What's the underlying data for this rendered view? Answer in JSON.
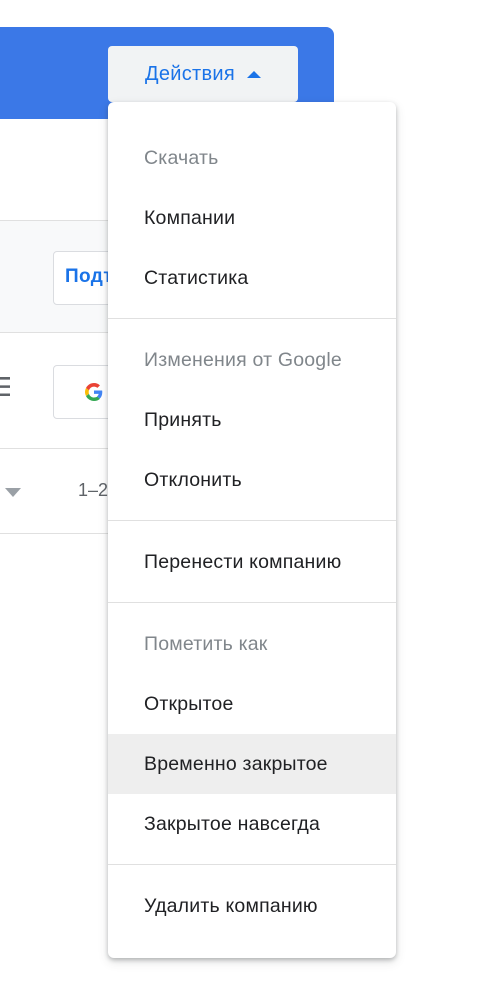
{
  "header": {
    "actions_label": "Действия"
  },
  "background": {
    "podt_label": "Подт",
    "pager_text": "1–2"
  },
  "menu": {
    "download_header": "Скачать",
    "companies": "Компании",
    "statistics": "Статистика",
    "google_changes_header": "Изменения от Google",
    "accept": "Принять",
    "reject": "Отклонить",
    "transfer": "Перенести компанию",
    "mark_as_header": "Пометить как",
    "open": "Открытое",
    "temp_closed": "Временно закрытое",
    "perm_closed": "Закрытое навсегда",
    "delete": "Удалить компанию"
  },
  "colors": {
    "accent": "#1a73e8",
    "header_bg": "#3b78e7",
    "highlight": "#eeeeee"
  }
}
